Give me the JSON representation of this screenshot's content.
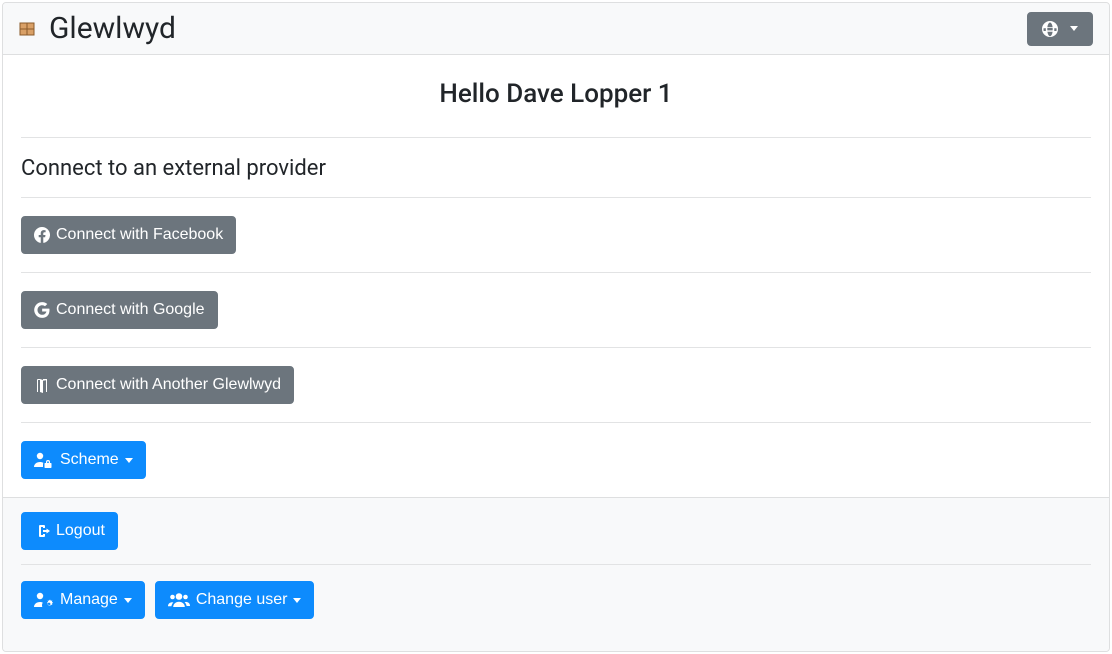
{
  "navbar": {
    "brand": "Glewlwyd"
  },
  "main": {
    "greeting": "Hello Dave Lopper 1",
    "section_title": "Connect to an external provider",
    "providers": {
      "facebook": "Connect with Facebook",
      "google": "Connect with Google",
      "glewlwyd": "Connect with Another Glewlwyd"
    },
    "scheme_label": "Scheme"
  },
  "footer": {
    "logout_label": "Logout",
    "manage_label": "Manage",
    "change_user_label": "Change user"
  }
}
